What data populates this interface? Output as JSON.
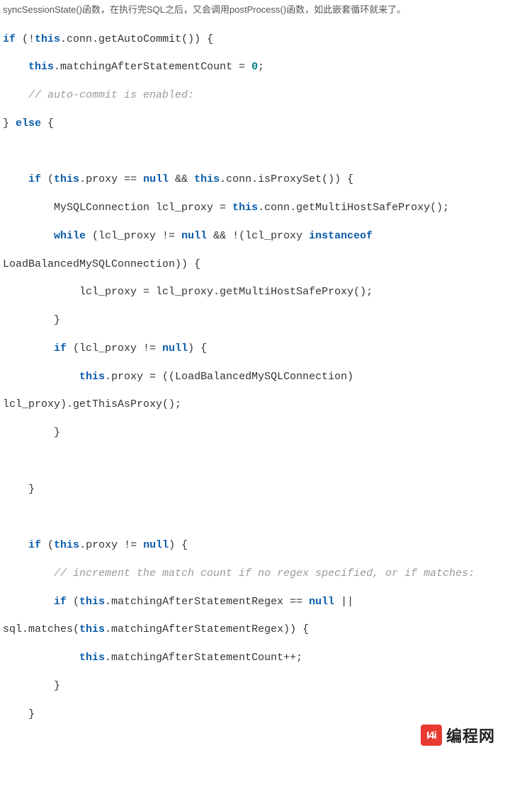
{
  "intro": "syncSessionState()函数，在执行完SQL之后，又会调用postProcess()函数，如此嵌套循环就来了。",
  "code": {
    "l01a": "if",
    "l01b": " (!",
    "l01c": "this",
    "l01d": ".conn.getAutoCommit()) {",
    "l02a": "    ",
    "l02b": "this",
    "l02c": ".matchingAfterStatementCount = ",
    "l02d": "0",
    "l02e": ";",
    "l03a": "    ",
    "l03b": "// auto-commit is enabled:",
    "l04a": "} ",
    "l04b": "else",
    "l04c": " {",
    "blank1": "",
    "l05a": "    ",
    "l05b": "if",
    "l05c": " (",
    "l05d": "this",
    "l05e": ".proxy == ",
    "l05f": "null",
    "l05g": " && ",
    "l05h": "this",
    "l05i": ".conn.isProxySet()) {",
    "l06a": "        MySQLConnection lcl_proxy = ",
    "l06b": "this",
    "l06c": ".conn.getMultiHostSafeProxy();",
    "l07a": "        ",
    "l07b": "while",
    "l07c": " (lcl_proxy != ",
    "l07d": "null",
    "l07e": " && !(lcl_proxy ",
    "l07f": "instanceof",
    "l07g": " LoadBalancedMySQLConnection)) {",
    "l08a": "            lcl_proxy = lcl_proxy.getMultiHostSafeProxy();",
    "l09a": "        }",
    "l10a": "        ",
    "l10b": "if",
    "l10c": " (lcl_proxy != ",
    "l10d": "null",
    "l10e": ") {",
    "l11a": "            ",
    "l11b": "this",
    "l11c": ".proxy = ((LoadBalancedMySQLConnection) lcl_proxy).getThisAsProxy();",
    "l12a": "        }",
    "blank2": "",
    "l13a": "    }",
    "blank3": "",
    "l14a": "    ",
    "l14b": "if",
    "l14c": " (",
    "l14d": "this",
    "l14e": ".proxy != ",
    "l14f": "null",
    "l14g": ") {",
    "l15a": "        ",
    "l15b": "// increment the match count if no regex specified, or if matches:",
    "l16a": "        ",
    "l16b": "if",
    "l16c": " (",
    "l16d": "this",
    "l16e": ".matchingAfterStatementRegex == ",
    "l16f": "null",
    "l16g": " || sql.matches(",
    "l16h": "this",
    "l16i": ".matchingAfterStatementRegex)) {",
    "l17a": "            ",
    "l17b": "this",
    "l17c": ".matchingAfterStatementCount++;",
    "l18a": "        }",
    "l19a": "    }"
  },
  "logo": {
    "mark": "I4i",
    "text": "编程网"
  }
}
